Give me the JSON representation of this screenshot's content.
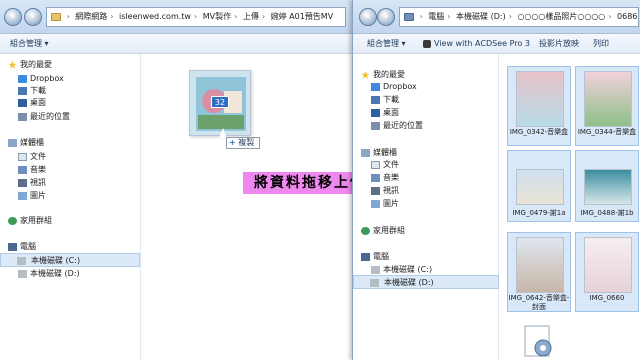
{
  "left_window": {
    "address": [
      "網際網路",
      "isleenwed.com.tw",
      "MV製作",
      "上傳",
      "婉婷 A01預告MV"
    ],
    "toolbar": {
      "organize_label": "組合管理 ▾"
    },
    "nav": {
      "favorites_header": "我的最愛",
      "favorites": [
        "Dropbox",
        "下載",
        "桌面",
        "最近的位置"
      ],
      "libraries_header": "媒體櫃",
      "libraries": [
        "文件",
        "音樂",
        "視訊",
        "圖片"
      ],
      "homegroup": "家用群組",
      "computer_header": "電腦",
      "drives": [
        "本機磁碟 (C:)",
        "本機磁碟 (D:)"
      ]
    }
  },
  "drag": {
    "badge_count": "32",
    "copy_label": "複製"
  },
  "banner_text": "將資料拖移上傳",
  "right_window": {
    "address": [
      "電腦",
      "本機磁碟 (D:)",
      "○○○○樣品照片○○○○",
      "0686"
    ],
    "toolbar": {
      "organize_label": "組合管理 ▾",
      "acdsee_label": "View with ACDSee Pro 3",
      "slideshow_label": "投影片放映",
      "print_label": "列印"
    },
    "nav": {
      "favorites_header": "我的最愛",
      "favorites": [
        "Dropbox",
        "下載",
        "桌面",
        "最近的位置"
      ],
      "libraries_header": "媒體櫃",
      "libraries": [
        "文件",
        "音樂",
        "視訊",
        "圖片"
      ],
      "homegroup": "家用群組",
      "computer_header": "電腦",
      "drives": [
        "本機磁碟 (C:)",
        "本機磁碟 (D:)"
      ]
    },
    "files": [
      {
        "name": "IMG_0342-音樂盒",
        "selected": true
      },
      {
        "name": "IMG_0344-音樂盒",
        "selected": true
      },
      {
        "name": "IMG_0479-謝1a",
        "selected": true
      },
      {
        "name": "IMG_0488-謝1b",
        "selected": true
      },
      {
        "name": "IMG_0642-音樂盒-封面",
        "selected": true
      },
      {
        "name": "IMG_0660",
        "selected": true
      }
    ]
  }
}
